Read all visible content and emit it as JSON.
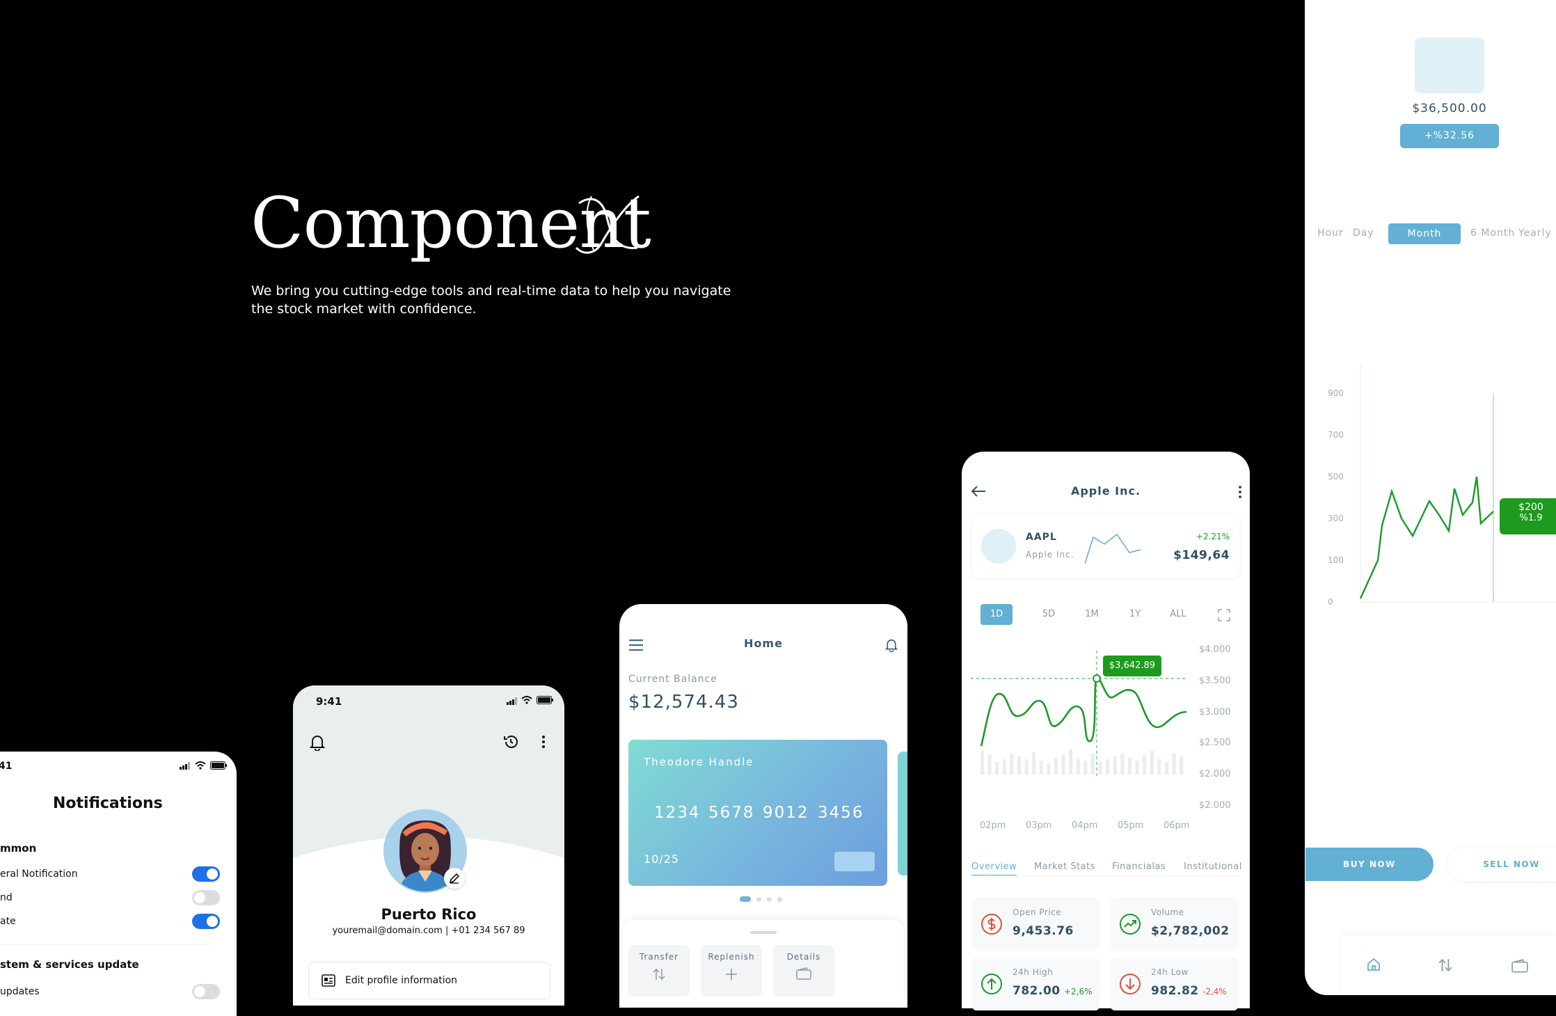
{
  "hero": {
    "title": "Component",
    "title_mark": "X",
    "subtitle": "We bring you cutting-edge tools and real-time data to help you navigate the stock market with confidence."
  },
  "notifications": {
    "status_time": "41",
    "title": "Notifications",
    "section_common": "mmon",
    "items": [
      {
        "label": "eral Notification",
        "on": true
      },
      {
        "label": "nd",
        "on": false
      },
      {
        "label": "ate",
        "on": true
      }
    ],
    "section_system": "stem & services update",
    "system_items": [
      {
        "label": "updates",
        "on": false
      }
    ]
  },
  "profile": {
    "status_time": "9:41",
    "name": "Puerto Rico",
    "contact": "youremail@domain.com | +01 234 567 89",
    "edit_label": "Edit profile information"
  },
  "home": {
    "title": "Home",
    "balance_label": "Current Balance",
    "balance": "$12,574.43",
    "card": {
      "holder": "Theodore Handle",
      "groups": [
        "1234",
        "5678",
        "9012",
        "3456"
      ],
      "expiry": "10/25"
    },
    "actions": [
      "Transfer",
      "Replenish",
      "Details"
    ]
  },
  "stock": {
    "title": "Apple Inc.",
    "ticker": "AAPL",
    "company": "Apple Inc.",
    "change": "+2.21%",
    "price": "$149,64",
    "ranges": [
      "1D",
      "5D",
      "1M",
      "1Y",
      "ALL"
    ],
    "active_range": "1D",
    "tooltip": "$3,642.89",
    "chart_data": {
      "type": "line",
      "y_ticks": [
        "$4.000",
        "$3.500",
        "$3.000",
        "$2.500",
        "$2.000",
        "$2.000"
      ],
      "x_ticks": [
        "02pm",
        "03pm",
        "04pm",
        "05pm",
        "06pm"
      ]
    },
    "tabs": [
      "Overview",
      "Market Stats",
      "Financialas",
      "Institutional"
    ],
    "stats": [
      {
        "label": "Open Price",
        "value": "9,453.76",
        "change": "",
        "icon": "dollar-icon"
      },
      {
        "label": "Volume",
        "value": "$2,782,002",
        "change": "",
        "icon": "trend-up-icon"
      },
      {
        "label": "24h High",
        "value": "782.00",
        "change": "+2,6%",
        "icon": "arrow-up-icon"
      },
      {
        "label": "24h Low",
        "value": "982.82",
        "change": "-2,4%",
        "icon": "arrow-down-icon"
      }
    ],
    "colors": {
      "up": "#1a9a2a",
      "down": "#e0503a",
      "accent": "#62b0d4"
    }
  },
  "detail": {
    "amount": "$36,500.00",
    "change": "+%32.56",
    "periods": [
      "Hour",
      "Day",
      "Month",
      "6 Month",
      "Yearly"
    ],
    "active_period": "Month",
    "chart_data": {
      "type": "line",
      "y_ticks": [
        "900",
        "700",
        "500",
        "300",
        "100",
        "0"
      ]
    },
    "badge_value": "$200",
    "badge_change": "%1.9",
    "buy_label": "BUY NOW",
    "sell_label": "SELL NOW"
  }
}
